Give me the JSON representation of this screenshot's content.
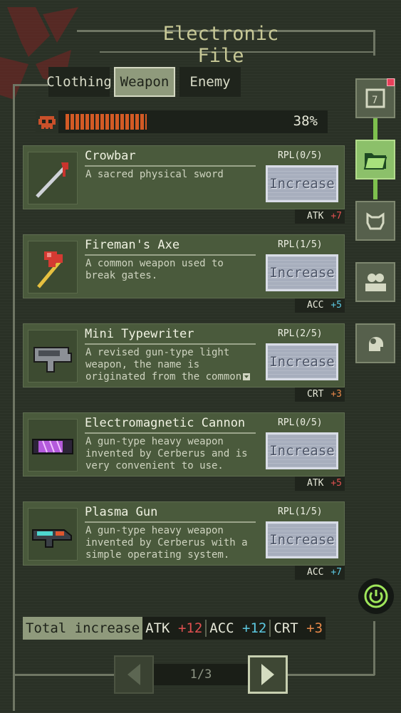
{
  "window": {
    "title": "Electronic File"
  },
  "tabs": [
    {
      "label": "Clothing",
      "active": false
    },
    {
      "label": "Weapon",
      "active": true
    },
    {
      "label": "Enemy",
      "active": false
    }
  ],
  "progress": {
    "percent_label": "38%",
    "fraction": 0.38,
    "icon": "skull-icon"
  },
  "items": [
    {
      "name": "Crowbar",
      "desc": "A sacred physical sword",
      "rpl": "RPL(0/5)",
      "button": "Increase",
      "stat": "ATK",
      "bonus": "+7",
      "bonus_color": "#e05050",
      "icon": "crowbar-icon"
    },
    {
      "name": "Fireman's Axe",
      "desc": "A common weapon used to break gates.",
      "rpl": "RPL(1/5)",
      "button": "Increase",
      "stat": "ACC",
      "bonus": "+5",
      "bonus_color": "#5cc8e0",
      "icon": "axe-icon"
    },
    {
      "name": "Mini Typewriter",
      "desc": "A revised gun-type light weapon, the name is originated from the common",
      "rpl": "RPL(2/5)",
      "button": "Increase",
      "stat": "CRT",
      "bonus": "+3",
      "bonus_color": "#e8894a",
      "icon": "typewriter-gun-icon"
    },
    {
      "name": "Electromagnetic Cannon",
      "desc": "A gun-type heavy weapon invented by Cerberus and is very convenient to use.",
      "rpl": "RPL(0/5)",
      "button": "Increase",
      "stat": "ATK",
      "bonus": "+5",
      "bonus_color": "#e05050",
      "icon": "cannon-icon"
    },
    {
      "name": "Plasma Gun",
      "desc": "A gun-type heavy weapon invented by Cerberus with a simple operating system.",
      "rpl": "RPL(1/5)",
      "button": "Increase",
      "stat": "ACC",
      "bonus": "+7",
      "bonus_color": "#5cc8e0",
      "icon": "plasma-gun-icon"
    }
  ],
  "totals": {
    "label": "Total increase",
    "atk_label": "ATK",
    "atk_value": "+12",
    "acc_label": "ACC",
    "acc_value": "+12",
    "crt_label": "CRT",
    "crt_value": "+3"
  },
  "pager": {
    "indicator": "1/3"
  },
  "sidebar": [
    {
      "icon": "notes-icon",
      "active": false
    },
    {
      "icon": "folder-icon",
      "active": true
    },
    {
      "icon": "dog-icon",
      "active": false
    },
    {
      "icon": "people-icon",
      "active": false
    },
    {
      "icon": "head-gear-icon",
      "active": false
    }
  ],
  "colors": {
    "accent_green": "#7ec04e",
    "progress_orange": "#d35a25",
    "atk": "#e05050",
    "acc": "#5cc8e0",
    "crt": "#e8894a"
  }
}
